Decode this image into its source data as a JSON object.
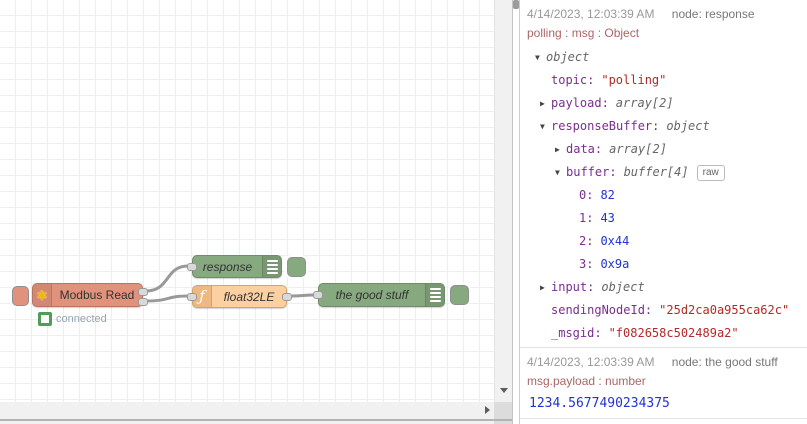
{
  "workspace": {
    "nodes": {
      "modbus": {
        "label": "Modbus Read",
        "status": "connected"
      },
      "response": {
        "label": "response"
      },
      "function": {
        "label": "float32LE",
        "icon_glyph": "ƒ"
      },
      "goodstuff": {
        "label": "the good stuff"
      }
    },
    "icons": {
      "modbus_glyph": "✱"
    }
  },
  "sidebar": {
    "messages": [
      {
        "timestamp": "4/14/2023, 12:03:39 AM",
        "node_label": "node: response",
        "path_line": "polling : msg : Object",
        "raw_button": "raw",
        "tree": [
          {
            "arrow": "▼",
            "key_label": "",
            "value": "object",
            "type": "meta"
          },
          {
            "arrow": "",
            "key_label": "topic:",
            "value": "\"polling\"",
            "type": "string"
          },
          {
            "arrow": "▶",
            "key_label": "payload:",
            "value": "array[2]",
            "type": "meta"
          },
          {
            "arrow": "▼",
            "key_label": "responseBuffer:",
            "value": "object",
            "type": "meta"
          },
          {
            "arrow": "▶",
            "key_label": "data:",
            "value": "array[2]",
            "type": "meta"
          },
          {
            "arrow": "▼",
            "key_label": "buffer:",
            "value": "buffer[4]",
            "type": "meta"
          },
          {
            "arrow": "",
            "key_label": "0:",
            "value": "82",
            "type": "number"
          },
          {
            "arrow": "",
            "key_label": "1:",
            "value": "43",
            "type": "number"
          },
          {
            "arrow": "",
            "key_label": "2:",
            "value": "0x44",
            "type": "number"
          },
          {
            "arrow": "",
            "key_label": "3:",
            "value": "0x9a",
            "type": "number"
          },
          {
            "arrow": "▶",
            "key_label": "input:",
            "value": "object",
            "type": "meta"
          },
          {
            "arrow": "",
            "key_label": "sendingNodeId:",
            "value": "\"25d2ca0a955ca62c\"",
            "type": "string"
          },
          {
            "arrow": "",
            "key_label": "_msgid:",
            "value": "\"f082658c502489a2\"",
            "type": "string"
          }
        ]
      },
      {
        "timestamp": "4/14/2023, 12:03:39 AM",
        "node_label": "node: the good stuff",
        "path_line": "msg.payload : number",
        "value": "1234.5677490234375"
      }
    ]
  },
  "colors": {
    "modbus_node": "#e0927c",
    "debug_node": "#87a980",
    "function_node": "#fdd0a2",
    "wire": "#999999",
    "status_green": "#4e9e57",
    "debug_key": "#792e90",
    "debug_string": "#b72828",
    "debug_number": "#2033d6",
    "debug_meta": "#666666",
    "debug_path": "#aa6666"
  }
}
